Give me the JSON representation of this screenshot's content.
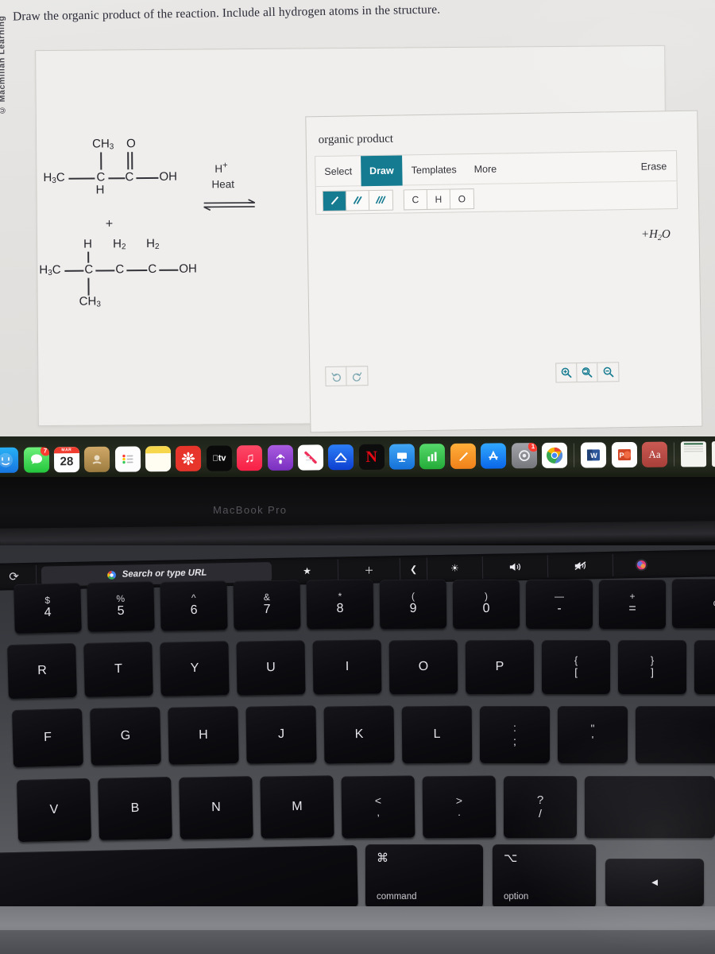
{
  "branding": {
    "watermark": "© Macmillan Learning"
  },
  "question": {
    "prompt": "Draw the organic product of the reaction. Include all hydrogen atoms in the structure."
  },
  "reaction": {
    "reactant1": {
      "name": "2-methylpropanoic acid",
      "left_label": "H3C",
      "top_substituent": "CH3",
      "carbonyl_oxygen": "O",
      "center_carbon": "C",
      "center_hydrogen": "H",
      "carbonyl_carbon": "C",
      "right_group": "OH"
    },
    "plus": "+",
    "reactant2": {
      "name": "3-methyl-1-butanol",
      "left_label": "H3C",
      "c2_label": "C",
      "c2_top": "H",
      "c2_bottom": "CH3",
      "c3_label": "C",
      "c3_top": "H2",
      "c4_label": "C",
      "c4_top": "H2",
      "right_group": "OH"
    },
    "conditions": {
      "catalyst": "H+",
      "energy": "Heat"
    },
    "arrow_type": "equilibrium",
    "byproduct": "+H2O"
  },
  "widget": {
    "title": "organic product",
    "tabs": [
      {
        "label": "Select",
        "active": false
      },
      {
        "label": "Draw",
        "active": true
      },
      {
        "label": "Templates",
        "active": false
      },
      {
        "label": "More",
        "active": false
      }
    ],
    "erase_label": "Erase",
    "bond_tools": [
      {
        "name": "single-bond",
        "selected": true
      },
      {
        "name": "double-bond",
        "selected": false
      },
      {
        "name": "triple-bond",
        "selected": false
      }
    ],
    "elements": [
      {
        "label": "C"
      },
      {
        "label": "H"
      },
      {
        "label": "O"
      }
    ],
    "history_buttons": [
      {
        "name": "undo",
        "enabled": false
      },
      {
        "name": "redo",
        "enabled": false
      }
    ],
    "zoom_buttons": [
      {
        "name": "zoom-in"
      },
      {
        "name": "zoom-reset"
      },
      {
        "name": "zoom-out"
      }
    ],
    "accent_color": "#157b91"
  },
  "dock": {
    "items": [
      {
        "name": "finder",
        "glyph": "",
        "bg": "#1b8ef2",
        "badge": ""
      },
      {
        "name": "messages",
        "glyph": "",
        "bg": "#4cd964",
        "badge": "7"
      },
      {
        "name": "calendar",
        "glyph": "28",
        "bg": "#ffffff",
        "badge": ""
      },
      {
        "name": "maps",
        "glyph": "",
        "bg": "#b79459",
        "badge": ""
      },
      {
        "name": "reminders",
        "glyph": "",
        "bg": "#fbfbfb",
        "badge": ""
      },
      {
        "name": "notes",
        "glyph": "",
        "bg": "#fcfcf6",
        "badge": ""
      },
      {
        "name": "photos-red-app",
        "glyph": "",
        "bg": "#e8352b",
        "badge": ""
      },
      {
        "name": "apple-tv",
        "glyph": "tv",
        "bg": "#0a0a0a",
        "badge": ""
      },
      {
        "name": "music",
        "glyph": "♫",
        "bg": "#fb2c56",
        "badge": ""
      },
      {
        "name": "podcasts",
        "glyph": "",
        "bg": "#8a3fd1",
        "badge": ""
      },
      {
        "name": "news",
        "glyph": "N",
        "bg": "#ffffff",
        "badge": ""
      },
      {
        "name": "safari-alt",
        "glyph": "",
        "bg": "#1560f0",
        "badge": ""
      },
      {
        "name": "netflix",
        "glyph": "N",
        "bg": "#111111",
        "badge": ""
      },
      {
        "name": "keynote",
        "glyph": "",
        "bg": "#2196f3",
        "badge": ""
      },
      {
        "name": "numbers",
        "glyph": "",
        "bg": "#31c24a",
        "badge": ""
      },
      {
        "name": "pages",
        "glyph": "",
        "bg": "#f79a1e",
        "badge": ""
      },
      {
        "name": "app-store",
        "glyph": "A",
        "bg": "#1b8ef2",
        "badge": ""
      },
      {
        "name": "system-settings",
        "glyph": "",
        "bg": "#8f9096",
        "badge": "1"
      },
      {
        "name": "google-chrome",
        "glyph": "",
        "bg": "#ffffff",
        "badge": ""
      },
      {
        "name": "microsoft-word",
        "glyph": "W",
        "bg": "#ffffff",
        "badge": ""
      },
      {
        "name": "microsoft-powerpoint",
        "glyph": "P",
        "bg": "#ffffff",
        "badge": ""
      },
      {
        "name": "dictionary",
        "glyph": "Aa",
        "bg": "#c0504a",
        "badge": ""
      },
      {
        "name": "recent-document-1",
        "glyph": "",
        "bg": "#f1f1ee",
        "badge": ""
      },
      {
        "name": "recent-document-2",
        "glyph": "",
        "bg": "#f1f1ee",
        "badge": ""
      },
      {
        "name": "trash",
        "glyph": "",
        "bg": "#9fa1a6",
        "badge": ""
      }
    ]
  },
  "laptop": {
    "model_label": "MacBook Pro"
  },
  "touchbar": {
    "refresh_icon": "⟳",
    "url_placeholder": "Search or type URL",
    "buttons": [
      "★",
      "＋",
      "❮",
      "☀",
      "🔊",
      "🔇",
      "siri"
    ]
  },
  "keyboard": {
    "row_number": [
      {
        "top": "$",
        "bot": "4"
      },
      {
        "top": "%",
        "bot": "5"
      },
      {
        "top": "^",
        "bot": "6"
      },
      {
        "top": "&",
        "bot": "7"
      },
      {
        "top": "*",
        "bot": "8"
      },
      {
        "top": "(",
        "bot": "9"
      },
      {
        "top": ")",
        "bot": "0"
      },
      {
        "top": "—",
        "bot": "-"
      },
      {
        "top": "+",
        "bot": "="
      },
      {
        "top": "",
        "bot": "de"
      }
    ],
    "row_top": [
      "R",
      "T",
      "Y",
      "U",
      "I",
      "O",
      "P",
      "{ [",
      "} ]"
    ],
    "row_home": [
      "F",
      "G",
      "H",
      "J",
      "K",
      "L",
      ": ;",
      "\" '"
    ],
    "row_bottom": [
      "V",
      "B",
      "N",
      "M",
      "< ,",
      "> .",
      "? /"
    ],
    "modifiers": [
      {
        "glyph": "⌘",
        "name": "command"
      },
      {
        "glyph": "⌥",
        "name": "option"
      }
    ]
  }
}
